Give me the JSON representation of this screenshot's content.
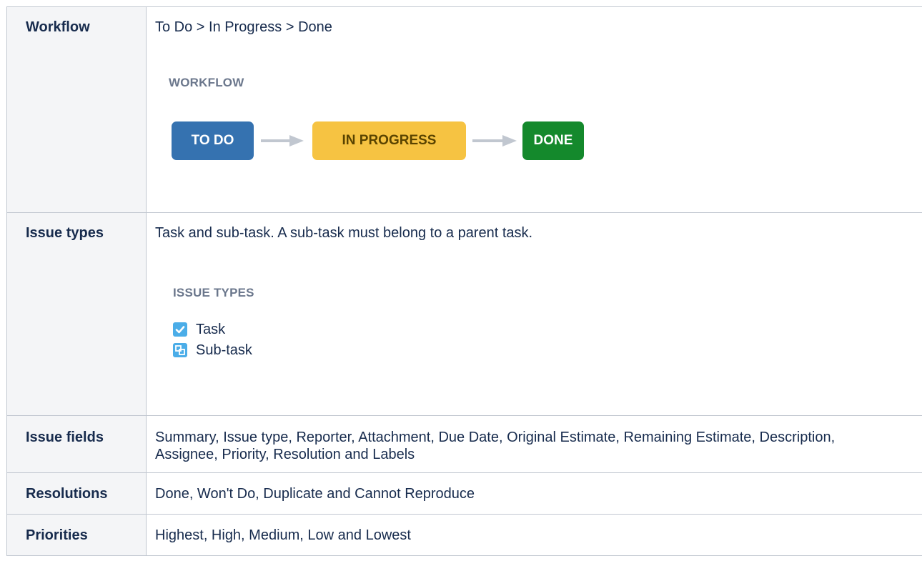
{
  "rows": {
    "workflow": {
      "label": "Workflow",
      "value": "To Do > In Progress > Done",
      "diagram": {
        "title": "WORKFLOW",
        "statuses": [
          {
            "label": "TO DO",
            "color": "#3572b0"
          },
          {
            "label": "IN PROGRESS",
            "color": "#f6c342"
          },
          {
            "label": "DONE",
            "color": "#14892c"
          }
        ]
      }
    },
    "issue_types": {
      "label": "Issue types",
      "value": "Task and sub-task. A sub-task must belong to a parent task.",
      "list_title": "ISSUE TYPES",
      "types": [
        {
          "label": "Task",
          "icon": "task-checkbox-icon"
        },
        {
          "label": "Sub-task",
          "icon": "subtask-icon"
        }
      ]
    },
    "issue_fields": {
      "label": "Issue fields",
      "value": "Summary, Issue type, Reporter, Attachment, Due Date, Original Estimate, Remaining Estimate, Description, Assignee, Priority, Resolution and Labels"
    },
    "resolutions": {
      "label": "Resolutions",
      "value": "Done, Won't Do, Duplicate and Cannot Reproduce"
    },
    "priorities": {
      "label": "Priorities",
      "value": "Highest, High, Medium, Low and Lowest"
    }
  },
  "colors": {
    "header_bg": "#f4f5f7",
    "border": "#c1c7d0",
    "todo": "#3572b0",
    "in_progress": "#f6c342",
    "done": "#14892c",
    "issue_icon": "#4bade8"
  }
}
